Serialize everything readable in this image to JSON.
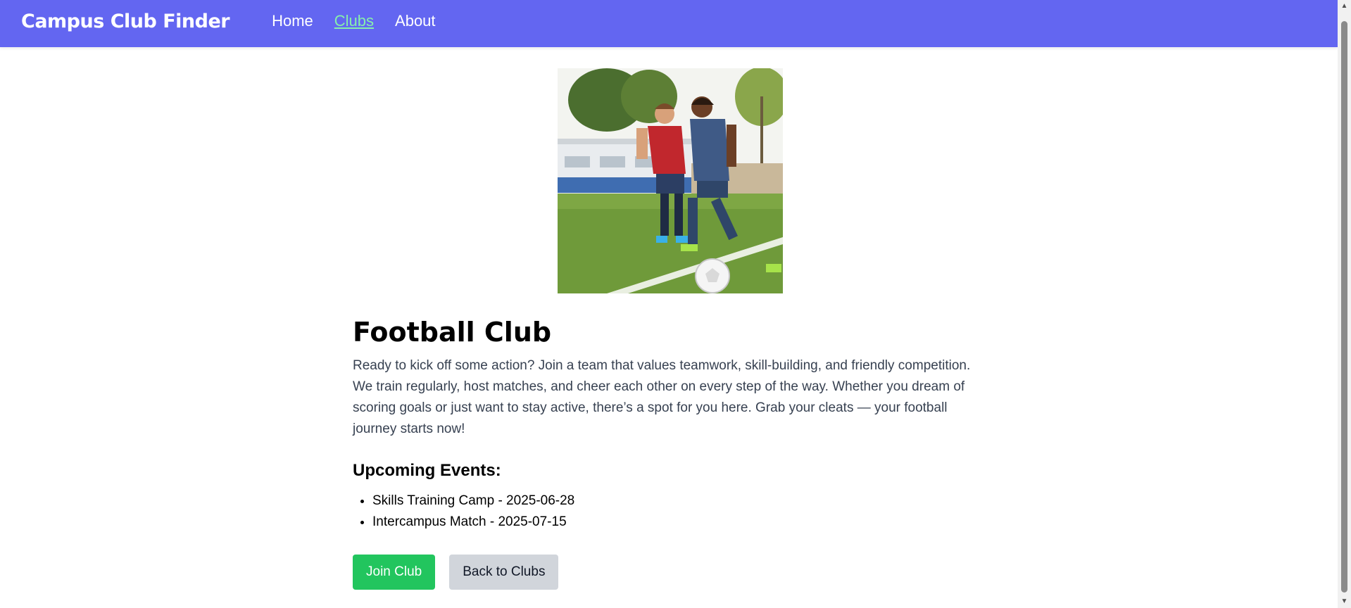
{
  "header": {
    "brand": "Campus Club Finder",
    "nav": [
      {
        "label": "Home",
        "active": false
      },
      {
        "label": "Clubs",
        "active": true
      },
      {
        "label": "About",
        "active": false
      }
    ]
  },
  "club": {
    "image_alt": "Two children playing football",
    "title": "Football Club",
    "description": "Ready to kick off some action? Join a team that values teamwork, skill-building, and friendly competition. We train regularly, host matches, and cheer each other on every step of the way. Whether you dream of scoring goals or just want to stay active, there’s a spot for you here. Grab your cleats — your football journey starts now!",
    "events_heading": "Upcoming Events:",
    "events": [
      "Skills Training Camp - 2025-06-28",
      "Intercampus Match - 2025-07-15"
    ]
  },
  "actions": {
    "join_label": "Join Club",
    "back_label": "Back to Clubs"
  },
  "colors": {
    "header_bg": "#6366f1",
    "nav_active": "#86efac",
    "join_bg": "#22c55e",
    "back_bg": "#d1d5db"
  },
  "scrollbar": {
    "up_icon": "chevron-up-icon",
    "down_icon": "chevron-down-icon"
  }
}
